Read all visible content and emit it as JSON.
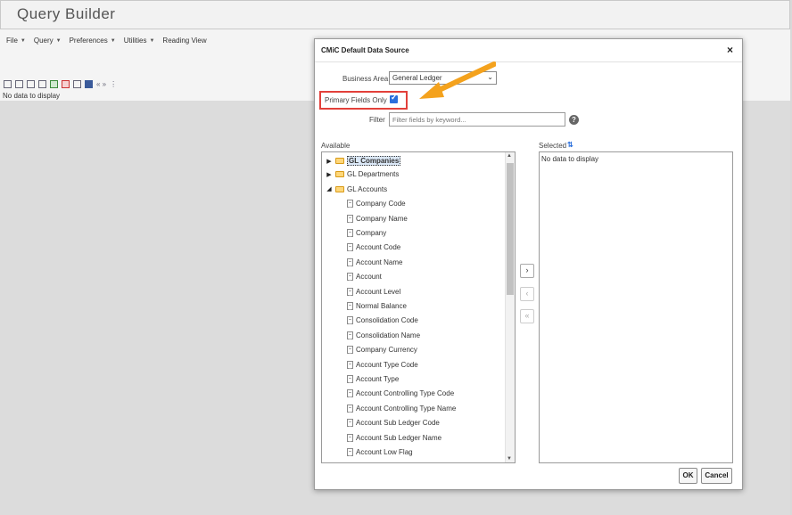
{
  "app": {
    "title": "Query Builder"
  },
  "menu": [
    {
      "label": "File",
      "caret": "▼"
    },
    {
      "label": "Query",
      "caret": "▼"
    },
    {
      "label": "Preferences",
      "caret": "▼"
    },
    {
      "label": "Utilities",
      "caret": "▼"
    },
    {
      "label": "Reading View",
      "caret": ""
    }
  ],
  "toolbar": {
    "icons": [
      "insert-column-icon",
      "sort-asc-icon",
      "sort-desc-icon",
      "filter-icon",
      "excel-icon",
      "pdf-icon",
      "copy-icon",
      "grid-icon",
      "prev-next-icon",
      "more-icon"
    ],
    "small": "« »",
    "more": "⋮"
  },
  "main": {
    "no_data": "No data to display"
  },
  "dialog": {
    "title": "CMiC Default Data Source",
    "close": "×",
    "business_area_label": "Business Area",
    "business_area_value": "General Ledger",
    "business_area_arrow": "⌄",
    "primary_fields_label": "Primary Fields Only",
    "primary_fields_checked": true,
    "filter_label": "Filter",
    "filter_placeholder": "Filter fields by keyword...",
    "help": "?",
    "available_label": "Available",
    "selected_label": "Selected",
    "selected_no_data": "No data to display",
    "ok": "OK",
    "cancel": "Cancel",
    "move_right": "›",
    "move_left": "‹",
    "move_all_left": "«",
    "tree": {
      "folders": [
        {
          "label": "GL Companies",
          "expanded": false,
          "selected": true
        },
        {
          "label": "GL Departments",
          "expanded": false,
          "selected": false
        },
        {
          "label": "GL Accounts",
          "expanded": true,
          "selected": false
        }
      ],
      "fields": [
        "Company Code",
        "Company Name",
        "Company",
        "Account Code",
        "Account Name",
        "Account",
        "Account Level",
        "Normal Balance",
        "Consolidation Code",
        "Consolidation Name",
        "Company Currency",
        "Account Type Code",
        "Account Type",
        "Account Controlling Type Code",
        "Account Controlling Type Name",
        "Account Sub Ledger Code",
        "Account Sub Ledger Name",
        "Account Low Flag"
      ]
    }
  },
  "colors": {
    "highlight_box": "#e2403a",
    "annotation_arrow": "#f4a21d",
    "checkbox": "#2a6fdc"
  }
}
